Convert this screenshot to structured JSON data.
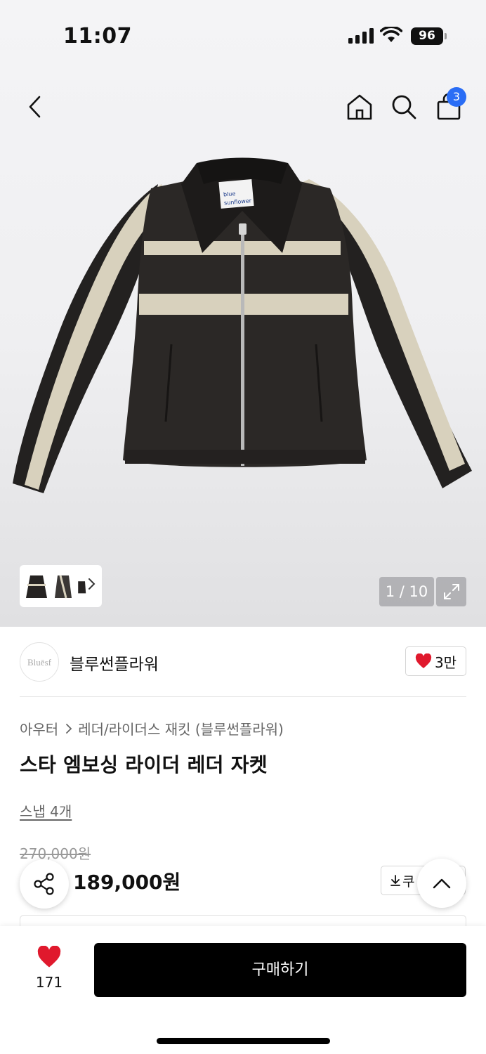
{
  "status_bar": {
    "time": "11:07",
    "battery": "96"
  },
  "nav": {
    "cart_count": "3"
  },
  "gallery": {
    "counter": "1 / 10",
    "jacket_tag_line1": "blue",
    "jacket_tag_line2": "sunflower"
  },
  "brand": {
    "logo_text": "Bluēsf",
    "name": "블루썬플라워",
    "like_count": "3만"
  },
  "product": {
    "breadcrumb": [
      "아우터",
      "레더/라이더스 재킷 (블루썬플라워)"
    ],
    "title": "스타 엠보싱 라이더 레더 자켓",
    "snap_link": "스냅 4개",
    "original_price": "270,000원",
    "sale_price": "189,000원",
    "coupon_label": "쿠"
  },
  "bottom_bar": {
    "wish_count": "171",
    "buy_label": "구매하기"
  },
  "colors": {
    "cart_badge": "#2a6df5",
    "heart": "#e0192d",
    "buy_button": "#000000"
  },
  "icons": [
    "back-icon",
    "home-icon",
    "search-icon",
    "cart-icon",
    "chevron-right-icon",
    "expand-icon",
    "heart-icon",
    "share-icon",
    "download-icon",
    "chevron-up-icon"
  ]
}
